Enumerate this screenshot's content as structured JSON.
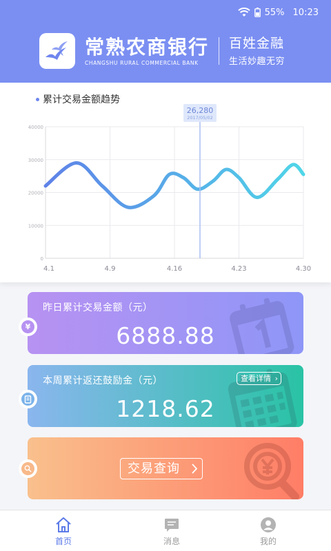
{
  "status_bar": {
    "battery": "55%",
    "time": "10:23"
  },
  "brand": {
    "name_cn": "常熟农商银行",
    "name_en": "CHANGSHU RURAL COMMERCIAL BANK",
    "slogan": "百姓金融",
    "tagline": "生活妙趣无穷"
  },
  "chart": {
    "title": "累计交易金额趋势",
    "tooltip_value": "26,280",
    "tooltip_date": "2017/05/02"
  },
  "chart_data": {
    "type": "line",
    "title": "累计交易金额趋势",
    "x_ticks": [
      "4.1",
      "4.9",
      "4.16",
      "4.23",
      "4.30"
    ],
    "y_ticks": [
      "0",
      "10000",
      "20000",
      "30000",
      "40000"
    ],
    "ylim": [
      0,
      40000
    ],
    "grid": true,
    "series": [
      {
        "values": [
          {
            "x": 0.0,
            "y": 22000
          },
          {
            "x": 0.12,
            "y": 29000
          },
          {
            "x": 0.22,
            "y": 22000
          },
          {
            "x": 0.32,
            "y": 15500
          },
          {
            "x": 0.42,
            "y": 19000
          },
          {
            "x": 0.48,
            "y": 25500
          },
          {
            "x": 0.535,
            "y": 24500
          },
          {
            "x": 0.59,
            "y": 21000
          },
          {
            "x": 0.65,
            "y": 23500
          },
          {
            "x": 0.7,
            "y": 27000
          },
          {
            "x": 0.75,
            "y": 24500
          },
          {
            "x": 0.82,
            "y": 18500
          },
          {
            "x": 0.9,
            "y": 24000
          },
          {
            "x": 0.96,
            "y": 28500
          },
          {
            "x": 1.0,
            "y": 25500
          }
        ],
        "color_start": "#5f82e8",
        "color_end": "#4fd6e8"
      }
    ],
    "highlight": {
      "label": "26,280",
      "date": "2017/05/02"
    }
  },
  "cards": {
    "yesterday": {
      "label": "昨日累计交易金额（元）",
      "value": "6888.88",
      "icon": "yuan-icon"
    },
    "week": {
      "label": "本周累计返还鼓励金（元）",
      "value": "1218.62",
      "detail": "查看详情",
      "icon": "receipt-icon"
    },
    "query": {
      "label": "交易查询",
      "icon": "search-icon"
    }
  },
  "tabs": [
    {
      "label": "首页",
      "icon": "home-icon",
      "active": true
    },
    {
      "label": "消息",
      "icon": "message-icon",
      "active": false
    },
    {
      "label": "我的",
      "icon": "profile-icon",
      "active": false
    }
  ],
  "colors": {
    "header": "#7b8ff2",
    "accent": "#5b7ae8",
    "card_purple": "#b792f2",
    "card_teal": "#29c3a5",
    "card_orange": "#ff7d66"
  }
}
